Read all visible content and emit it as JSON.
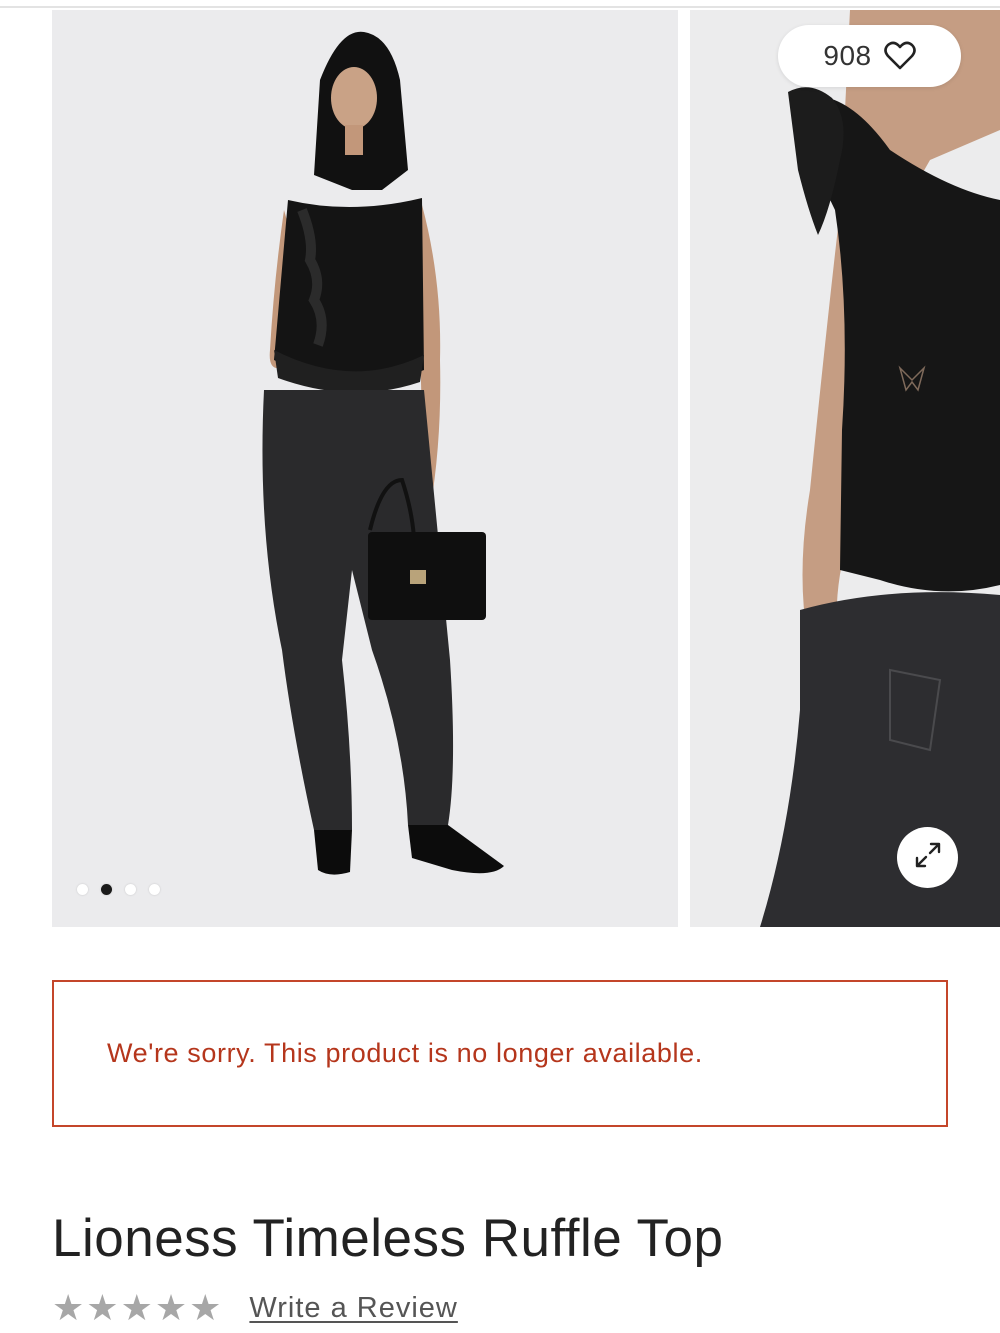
{
  "gallery": {
    "slide_count": 4,
    "active_slide_index": 1,
    "favorites": {
      "count": "908",
      "icon": "heart-outline-icon"
    },
    "expand_icon": "expand-arrows-icon"
  },
  "notice": {
    "message": "We're sorry. This product is no longer available."
  },
  "product": {
    "title": "Lioness Timeless Ruffle Top",
    "rating": {
      "value": 0,
      "max": 5
    },
    "write_review_label": "Write a Review"
  },
  "colors": {
    "alert": "#c4462a",
    "alert_text": "#b5361c",
    "star_empty": "#a7a7a7"
  }
}
